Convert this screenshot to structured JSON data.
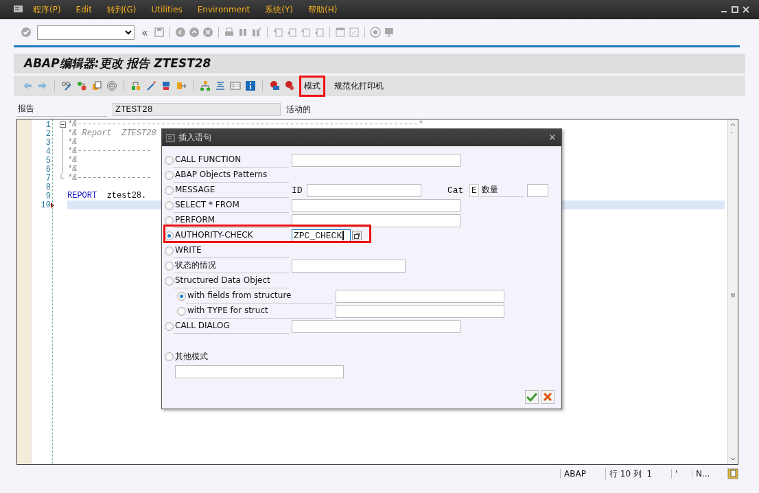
{
  "menu_bar": {
    "items": [
      "程序(P)",
      "Edit",
      "转到(G)",
      "Utilities",
      "Environment",
      "系统(Y)",
      "帮助(H)"
    ]
  },
  "system_toolbar": {
    "collapse": "«"
  },
  "title": "ABAP编辑器:更改 报告 ZTEST28",
  "app_toolbar": {
    "buttons": [
      {
        "label": "模式",
        "highlighted": true
      },
      {
        "label": "规范化打印机",
        "highlighted": false
      }
    ]
  },
  "report": {
    "label": "报告",
    "value": "ZTEST28",
    "status": "活动的"
  },
  "editor": {
    "lines": [
      {
        "number": "1",
        "kind": "comment",
        "text": "*&---------------------------------------------------------------------*",
        "expanded": true,
        "current": false
      },
      {
        "number": "2",
        "kind": "comment",
        "text": "*& Report  ZTEST28",
        "current": false
      },
      {
        "number": "3",
        "kind": "comment",
        "text": "*&",
        "current": false
      },
      {
        "number": "4",
        "kind": "comment",
        "text": "*&---------------",
        "current": false
      },
      {
        "number": "5",
        "kind": "comment",
        "text": "*&",
        "current": false
      },
      {
        "number": "6",
        "kind": "comment",
        "text": "*&",
        "current": false
      },
      {
        "number": "7",
        "kind": "comment",
        "text": "*&---------------",
        "current": false
      },
      {
        "number": "8",
        "kind": "blank",
        "current": false
      },
      {
        "number": "9",
        "kind": "code",
        "keyword": "REPORT",
        "text": "ztest28.",
        "current": false
      },
      {
        "number": "10",
        "kind": "blank",
        "current": true
      }
    ]
  },
  "dialog": {
    "title": "插入语句",
    "close": "×",
    "options": [
      {
        "label": "CALL FUNCTION",
        "kind": "field",
        "selected": false,
        "highlighted": false
      },
      {
        "label": "ABAP Objects Patterns",
        "kind": "plain",
        "selected": false,
        "highlighted": false
      },
      {
        "label": "MESSAGE",
        "kind": "message",
        "selected": false,
        "highlighted": false,
        "id_label": "ID",
        "cat_label": "Cat",
        "cat_value": "E",
        "number_label": "数量"
      },
      {
        "label": "SELECT * FROM",
        "kind": "field",
        "selected": false,
        "highlighted": false
      },
      {
        "label": "PERFORM",
        "kind": "field",
        "selected": false,
        "highlighted": false
      },
      {
        "label": "AUTHORITY-CHECK",
        "kind": "value",
        "selected": true,
        "highlighted": true,
        "value": "ZPC_CHECK"
      },
      {
        "label": "WRITE",
        "kind": "plain",
        "selected": false,
        "highlighted": false
      },
      {
        "label": "状态的情况",
        "kind": "short",
        "selected": false,
        "highlighted": false
      },
      {
        "label": "Structured Data Object",
        "kind": "group",
        "selected": false,
        "highlighted": false,
        "children": [
          {
            "label": "with fields from structure",
            "selected": true
          },
          {
            "label": "with TYPE for struct",
            "selected": false
          }
        ]
      },
      {
        "label": "CALL DIALOG",
        "kind": "field",
        "selected": false,
        "highlighted": false
      },
      {
        "label": "其他模式",
        "kind": "below",
        "selected": false,
        "highlighted": false
      }
    ]
  },
  "status_bar": {
    "segments": [
      "ABAP",
      "行 10 列  1",
      "'",
      "N..."
    ]
  }
}
